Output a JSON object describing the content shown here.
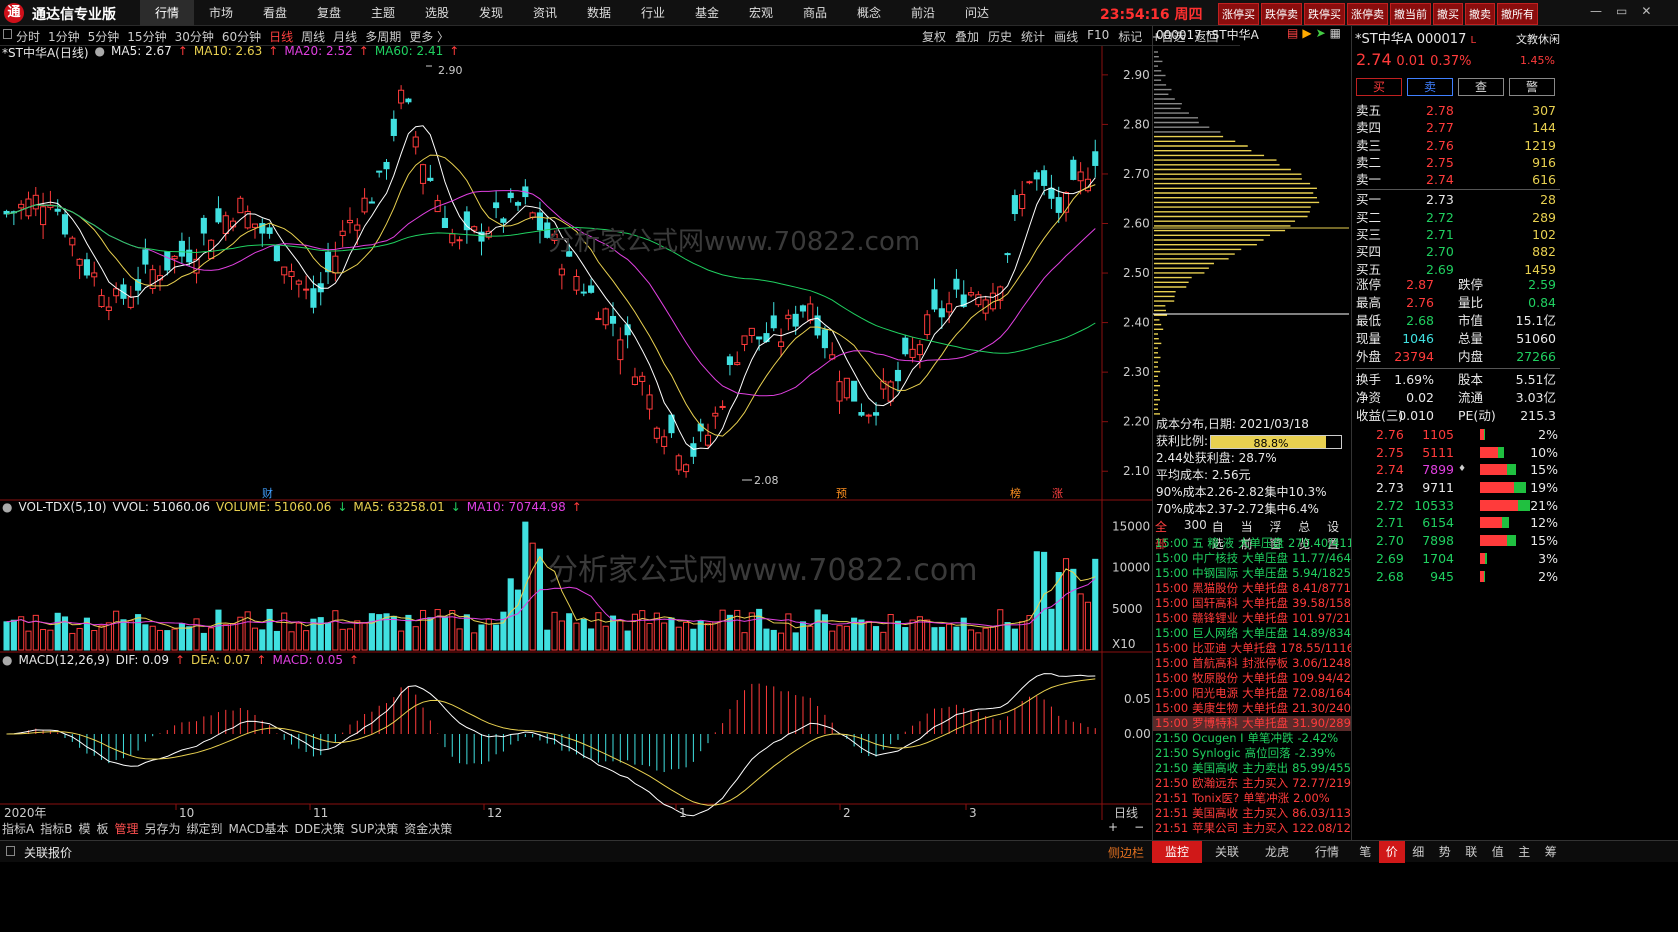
{
  "app": {
    "title": "通达信专业版",
    "logo": "通"
  },
  "menu": [
    "行情",
    "市场",
    "看盘",
    "复盘",
    "主题",
    "选股",
    "发现",
    "资讯",
    "数据",
    "行业",
    "基金",
    "宏观",
    "商品",
    "概念",
    "前沿",
    "问达"
  ],
  "menu_active": 0,
  "clock": {
    "time": "23:54:16",
    "weekday": "周四"
  },
  "quick_buttons": [
    "涨停买",
    "跌停卖",
    "跌停买",
    "涨停卖",
    "撤当前",
    "撤买",
    "撤卖",
    "撤所有"
  ],
  "window_controls": [
    "—",
    "▭",
    "✕"
  ],
  "periods": [
    "分时",
    "1分钟",
    "5分钟",
    "15分钟",
    "30分钟",
    "60分钟",
    "日线",
    "周线",
    "月线",
    "多周期",
    "更多 〉"
  ],
  "period_active": 6,
  "tools": [
    "复权",
    "叠加",
    "历史",
    "统计",
    "画线",
    "F10",
    "标记",
    "+自选",
    "返回"
  ],
  "kline_header": {
    "name": "*ST中华A(日线)",
    "ma5": "MA5: 2.67",
    "ma10": "MA10: 2.63",
    "ma20": "MA20: 2.52",
    "ma60": "MA60: 2.41"
  },
  "price_axis": [
    "2.90",
    "2.80",
    "2.70",
    "2.60",
    "2.50",
    "2.40",
    "2.30",
    "2.20",
    "2.10"
  ],
  "high_label": "2.90",
  "low_label": "2.08",
  "event_markers": [
    "财",
    "预",
    "榜",
    "涨"
  ],
  "watermark": "分析家公式网www.70822.com",
  "vol_header": {
    "name": "VOL-TDX(5,10)",
    "vvol": "VVOL: 51060.06",
    "volume": "VOLUME: 51060.06",
    "ma5": "MA5: 63258.01",
    "ma10": "MA10: 70744.98"
  },
  "vol_axis": [
    "15000",
    "10000",
    "5000",
    "X10"
  ],
  "macd_header": {
    "name": "MACD(12,26,9)",
    "dif": "DIF: 0.09",
    "dea": "DEA: 0.07",
    "macd": "MACD: 0.05"
  },
  "macd_axis": [
    "0.05",
    "0.00"
  ],
  "date_axis": [
    "2020年",
    "10",
    "11",
    "12",
    "1",
    "2",
    "3",
    "日线"
  ],
  "bottom_tabs": [
    "指标A",
    "指标B",
    "模",
    "板",
    "管理",
    "另存为",
    "绑定到",
    "MACD基本",
    "DDE决策",
    "SUP决策",
    "资金决策"
  ],
  "bottom_tab_active": 4,
  "zoom_buttons": [
    "+",
    "−"
  ],
  "status": {
    "left": "关联报价",
    "sidebar": "侧边栏",
    "tabs": [
      "监控",
      "关联",
      "龙虎",
      "行情"
    ]
  },
  "cost": {
    "header": "000017 *ST中华A",
    "date": "成本分布,日期: 2021/03/18",
    "profit_label": "获利比例:",
    "profit_ratio": "88.8%",
    "profit_ratio_value": 0.888,
    "line3": "2.44处获利盘: 28.7%",
    "line4": "平均成本: 2.56元",
    "line5": "90%成本2.26-2.82集中10.3%",
    "line6": "70%成本2.37-2.72集中6.4%"
  },
  "monitor_tabs": [
    "全部",
    "300",
    "自选",
    "当前",
    "浮窗",
    "总览",
    "设置"
  ],
  "monitor_rows": [
    {
      "time": "15:00",
      "name": "五 粮 液",
      "type": "大单压盘",
      "val": "270.40/411",
      "color": "g"
    },
    {
      "time": "15:00",
      "name": "中广核技",
      "type": "大单压盘",
      "val": "11.77/4643",
      "color": "g"
    },
    {
      "time": "15:00",
      "name": "中钢国际",
      "type": "大单压盘",
      "val": "5.94/18251",
      "color": "g"
    },
    {
      "time": "15:00",
      "name": "黑猫股份",
      "type": "大单托盘",
      "val": "8.41/8771",
      "color": "r"
    },
    {
      "time": "15:00",
      "name": "国轩高科",
      "type": "大单托盘",
      "val": "39.58/1581",
      "color": "r"
    },
    {
      "time": "15:00",
      "name": "赣锋锂业",
      "type": "大单托盘",
      "val": "101.97/2123",
      "color": "r"
    },
    {
      "time": "15:00",
      "name": "巨人网络",
      "type": "大单压盘",
      "val": "14.89/8348",
      "color": "g"
    },
    {
      "time": "15:00",
      "name": "比亚迪",
      "type": "大单托盘",
      "val": "178.55/1116",
      "color": "r"
    },
    {
      "time": "15:00",
      "name": "首航高科",
      "type": "封涨停板",
      "val": "3.06/12486",
      "color": "r"
    },
    {
      "time": "15:00",
      "name": "牧原股份",
      "type": "大单托盘",
      "val": "109.94/4237",
      "color": "r"
    },
    {
      "time": "15:00",
      "name": "阳光电源",
      "type": "大单托盘",
      "val": "72.08/1642",
      "color": "r"
    },
    {
      "time": "15:00",
      "name": "美康生物",
      "type": "大单托盘",
      "val": "21.30/2404",
      "color": "r"
    },
    {
      "time": "15:00",
      "name": "罗博特科",
      "type": "大单托盘",
      "val": "31.90/2899",
      "color": "r",
      "hl": true
    },
    {
      "time": "21:50",
      "name": "Ocugen I",
      "type": "单笔冲跌",
      "val": "-2.42%",
      "color": "g"
    },
    {
      "time": "21:50",
      "name": "Synlogic",
      "type": "高位回落",
      "val": "-2.39%",
      "color": "g"
    },
    {
      "time": "21:50",
      "name": "美国高收",
      "type": "主力卖出",
      "val": "85.99/45540",
      "color": "g"
    },
    {
      "time": "21:50",
      "name": "欧瀚远东",
      "type": "主力买入",
      "val": "72.77/21928",
      "color": "r"
    },
    {
      "time": "21:51",
      "name": "Tonix医?",
      "type": "单笔冲涨",
      "val": "2.00%",
      "color": "r"
    },
    {
      "time": "21:51",
      "name": "美国高收",
      "type": "主力买入",
      "val": "86.03/11379",
      "color": "r"
    },
    {
      "time": "21:51",
      "name": "苹果公司",
      "type": "主力买入",
      "val": "122.08/1239",
      "color": "r"
    }
  ],
  "quote": {
    "title": "*ST中华A 000017",
    "badge": "L",
    "tag": "文教休闲",
    "price": "2.74",
    "change": "0.01",
    "pct": "0.37%",
    "pct2": "1.45%",
    "buttons": [
      "买",
      "卖",
      "查",
      "警"
    ]
  },
  "asks": [
    {
      "l": "卖五",
      "p": "2.78",
      "v": "307"
    },
    {
      "l": "卖四",
      "p": "2.77",
      "v": "144"
    },
    {
      "l": "卖三",
      "p": "2.76",
      "v": "1219"
    },
    {
      "l": "卖二",
      "p": "2.75",
      "v": "916"
    },
    {
      "l": "卖一",
      "p": "2.74",
      "v": "616"
    }
  ],
  "bids": [
    {
      "l": "买一",
      "p": "2.73",
      "v": "28"
    },
    {
      "l": "买二",
      "p": "2.72",
      "v": "289"
    },
    {
      "l": "买三",
      "p": "2.71",
      "v": "102"
    },
    {
      "l": "买四",
      "p": "2.70",
      "v": "882"
    },
    {
      "l": "买五",
      "p": "2.69",
      "v": "1459"
    }
  ],
  "stats1": [
    [
      "涨停",
      "2.87",
      "r",
      "跌停",
      "2.59",
      "g"
    ],
    [
      "最高",
      "2.76",
      "r",
      "量比",
      "0.84",
      "g"
    ],
    [
      "最低",
      "2.68",
      "g",
      "市值",
      "15.1亿",
      "w"
    ],
    [
      "现量",
      "1046",
      "c",
      "总量",
      "51060",
      "w"
    ],
    [
      "外盘",
      "23794",
      "r",
      "内盘",
      "27266",
      "g"
    ]
  ],
  "stats2": [
    [
      "换手",
      "1.69%",
      "w",
      "股本",
      "5.51亿",
      "w"
    ],
    [
      "净资",
      "0.02",
      "w",
      "流通",
      "3.03亿",
      "w"
    ],
    [
      "收益(三)",
      "0.010",
      "w",
      "PE(动)",
      "215.3",
      "w"
    ]
  ],
  "ticks": [
    {
      "p": "2.76",
      "v": "1105",
      "pct": "2%",
      "f": 0.02
    },
    {
      "p": "2.75",
      "v": "5111",
      "pct": "10%",
      "f": 0.1
    },
    {
      "p": "2.74",
      "v": "7899",
      "pct": "15%",
      "f": 0.15,
      "cur": true
    },
    {
      "p": "2.73",
      "v": "9711",
      "pct": "19%",
      "f": 0.19
    },
    {
      "p": "2.72",
      "v": "10533",
      "pct": "21%",
      "f": 0.21
    },
    {
      "p": "2.71",
      "v": "6154",
      "pct": "12%",
      "f": 0.12
    },
    {
      "p": "2.70",
      "v": "7898",
      "pct": "15%",
      "f": 0.15
    },
    {
      "p": "2.69",
      "v": "1704",
      "pct": "3%",
      "f": 0.03
    },
    {
      "p": "2.68",
      "v": "945",
      "pct": "2%",
      "f": 0.02
    }
  ],
  "right_tabs": [
    "笔",
    "价",
    "细",
    "势",
    "联",
    "值",
    "主",
    "筹"
  ],
  "right_tab_active": 1
}
